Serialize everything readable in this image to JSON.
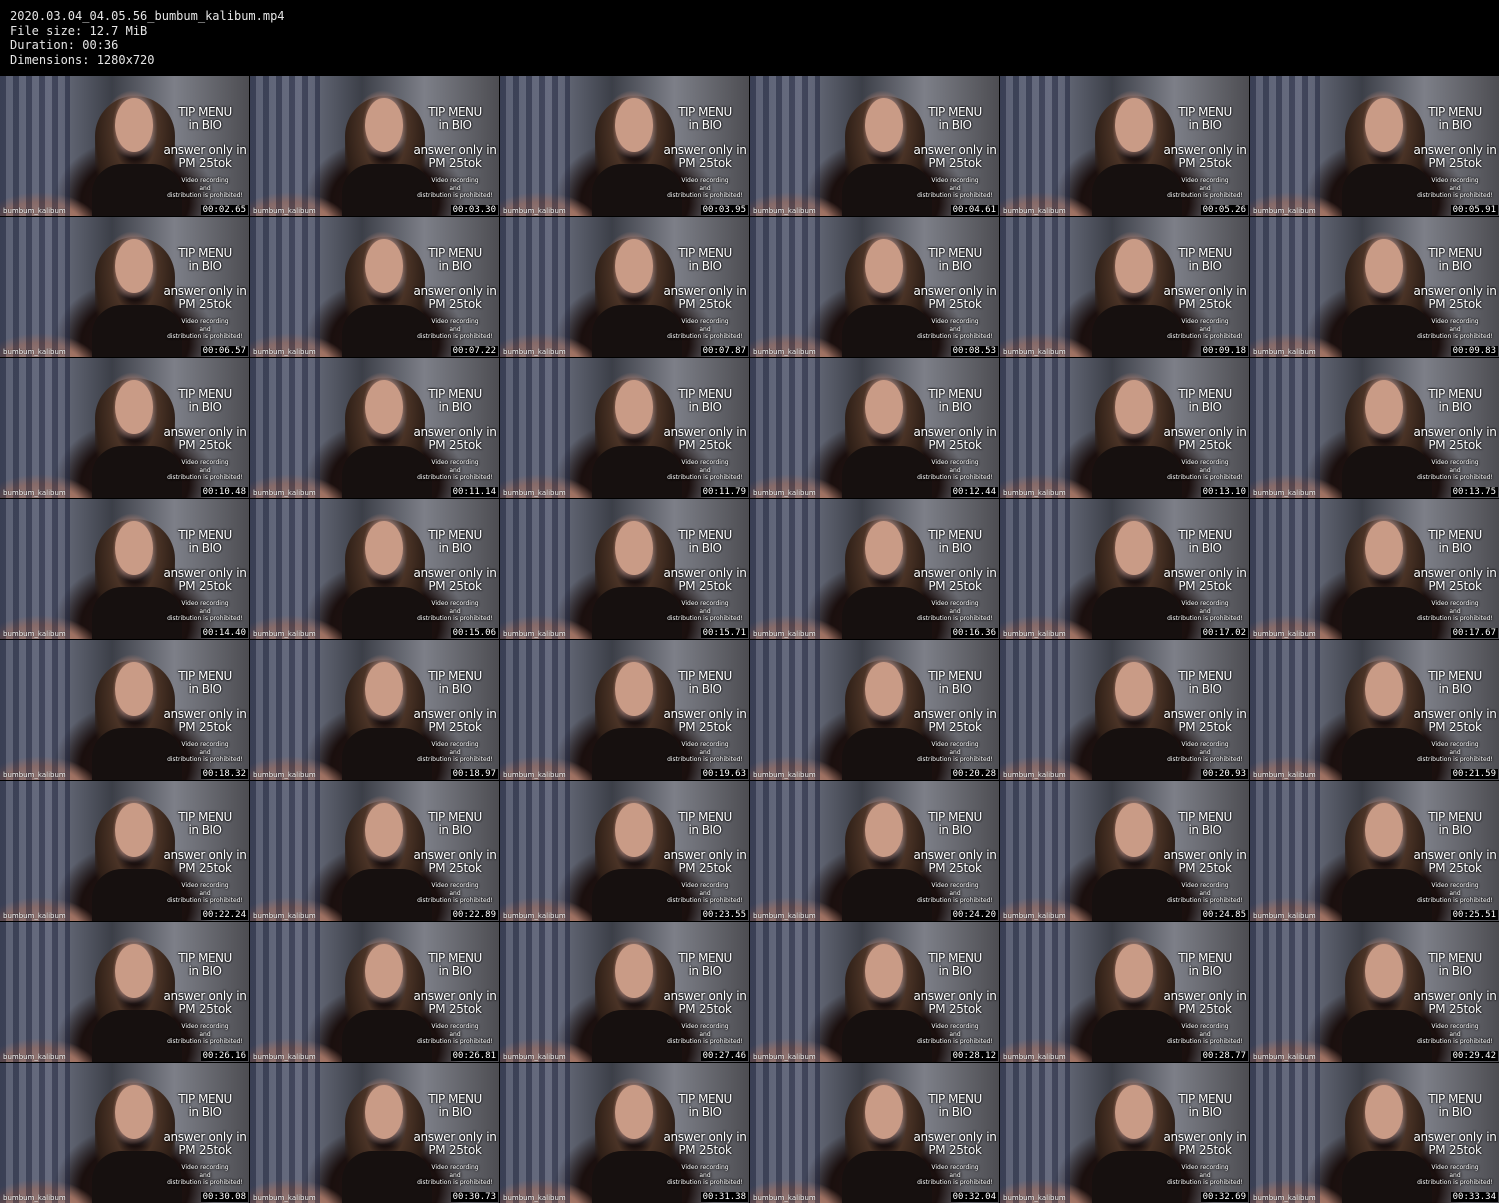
{
  "header": {
    "filename_line": "2020.03.04_04.05.56_bumbum_kalibum.mp4",
    "filesize_line": "File size: 12.7 MiB",
    "duration_line": "Duration: 00:36",
    "dimensions_line": "Dimensions: 1280x720"
  },
  "overlay": {
    "tip_line1": "TIP MENU",
    "tip_line2": "in BIO",
    "answer_line1": "answer only in",
    "answer_line2": "PM 25tok",
    "rec_line1": "Video recording",
    "rec_line2": "and",
    "rec_line3": "distribution is prohibited!",
    "watermark": "bumbum_kalibum"
  },
  "thumbnails": [
    {
      "timestamp": "00:02.65"
    },
    {
      "timestamp": "00:03.30"
    },
    {
      "timestamp": "00:03.95"
    },
    {
      "timestamp": "00:04.61"
    },
    {
      "timestamp": "00:05.26"
    },
    {
      "timestamp": "00:05.91"
    },
    {
      "timestamp": "00:06.57"
    },
    {
      "timestamp": "00:07.22"
    },
    {
      "timestamp": "00:07.87"
    },
    {
      "timestamp": "00:08.53"
    },
    {
      "timestamp": "00:09.18"
    },
    {
      "timestamp": "00:09.83"
    },
    {
      "timestamp": "00:10.48"
    },
    {
      "timestamp": "00:11.14"
    },
    {
      "timestamp": "00:11.79"
    },
    {
      "timestamp": "00:12.44"
    },
    {
      "timestamp": "00:13.10"
    },
    {
      "timestamp": "00:13.75"
    },
    {
      "timestamp": "00:14.40"
    },
    {
      "timestamp": "00:15.06"
    },
    {
      "timestamp": "00:15.71"
    },
    {
      "timestamp": "00:16.36"
    },
    {
      "timestamp": "00:17.02"
    },
    {
      "timestamp": "00:17.67"
    },
    {
      "timestamp": "00:18.32"
    },
    {
      "timestamp": "00:18.97"
    },
    {
      "timestamp": "00:19.63"
    },
    {
      "timestamp": "00:20.28"
    },
    {
      "timestamp": "00:20.93"
    },
    {
      "timestamp": "00:21.59"
    },
    {
      "timestamp": "00:22.24"
    },
    {
      "timestamp": "00:22.89"
    },
    {
      "timestamp": "00:23.55"
    },
    {
      "timestamp": "00:24.20"
    },
    {
      "timestamp": "00:24.85"
    },
    {
      "timestamp": "00:25.51"
    },
    {
      "timestamp": "00:26.16"
    },
    {
      "timestamp": "00:26.81"
    },
    {
      "timestamp": "00:27.46"
    },
    {
      "timestamp": "00:28.12"
    },
    {
      "timestamp": "00:28.77"
    },
    {
      "timestamp": "00:29.42"
    },
    {
      "timestamp": "00:30.08"
    },
    {
      "timestamp": "00:30.73"
    },
    {
      "timestamp": "00:31.38"
    },
    {
      "timestamp": "00:32.04"
    },
    {
      "timestamp": "00:32.69"
    },
    {
      "timestamp": "00:33.34"
    }
  ]
}
